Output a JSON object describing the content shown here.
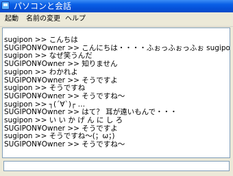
{
  "window": {
    "title": "パソコンと会話"
  },
  "menu": [
    {
      "label": "起動"
    },
    {
      "label": "名前の変更"
    },
    {
      "label": "ヘルプ"
    }
  ],
  "chat": {
    "lines": [
      "sugipon >> こんちは",
      "SUGIPON¥Owner >> こんにちは・・・・ふぉっふぉっふぉ sugipon",
      "sugipon >> なぜ笑うんだ",
      "SUGIPON¥Owner >> 知りません",
      "sugipon >> わかれよ",
      "SUGIPON¥Owner >> そうですよ",
      "sugipon >> そうですね",
      "SUGIPON¥Owner >> そうですね〜",
      "sugipon >> ┐(´∀`)┌ …",
      "SUGIPON¥Owner >> はて？ 耳が遠いもんで・・・",
      "sugipon >> い い か げ ん に し ろ",
      "SUGIPON¥Owner >> そうですよ",
      "sugipon >> そうですね〜(；ω；)",
      "SUGIPON¥Owner >> そうですね〜"
    ]
  },
  "input": {
    "value": ""
  }
}
